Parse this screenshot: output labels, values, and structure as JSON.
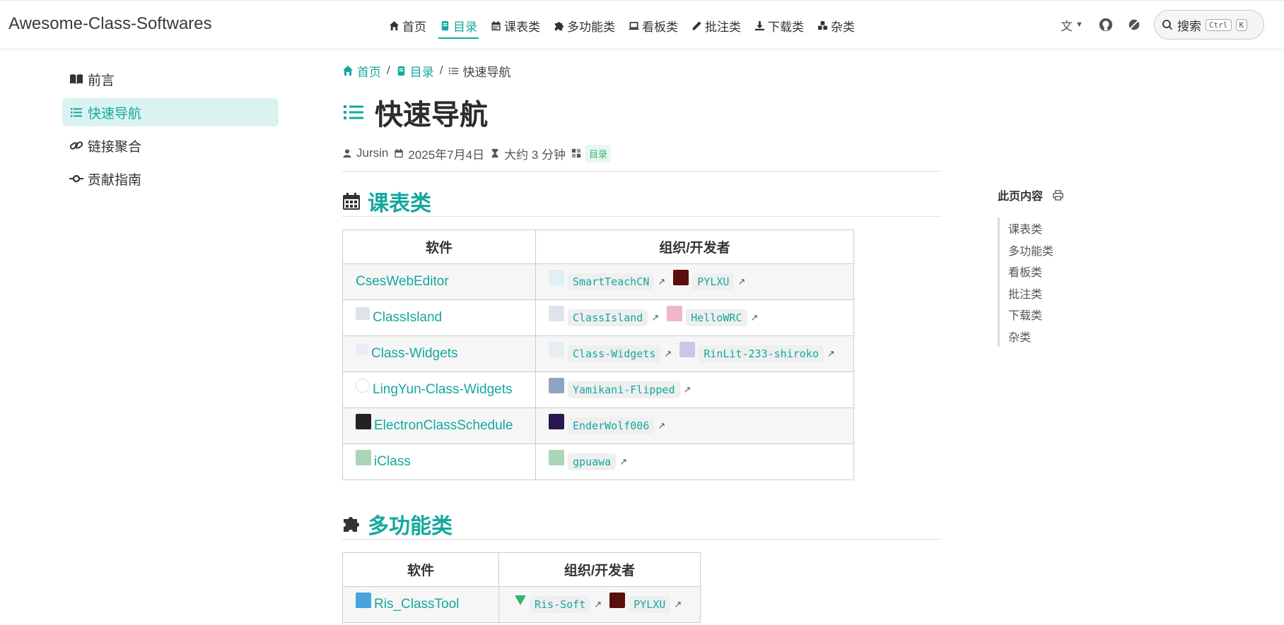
{
  "site": {
    "brand": "Awesome-Class-Softwares"
  },
  "nav": {
    "links": [
      {
        "label": "首页",
        "icon": "home-icon",
        "active": false
      },
      {
        "label": "目录",
        "icon": "book-icon",
        "active": true
      },
      {
        "label": "课表类",
        "icon": "calendar-icon",
        "active": false
      },
      {
        "label": "多功能类",
        "icon": "puzzle-icon",
        "active": false
      },
      {
        "label": "看板类",
        "icon": "laptop-icon",
        "active": false
      },
      {
        "label": "批注类",
        "icon": "pen-icon",
        "active": false
      },
      {
        "label": "下载类",
        "icon": "download-icon",
        "active": false
      },
      {
        "label": "杂类",
        "icon": "cubes-icon",
        "active": false
      }
    ],
    "search_label": "搜索",
    "search_key1": "Ctrl",
    "search_key2": "K"
  },
  "sidebar": {
    "items": [
      {
        "label": "前言",
        "icon": "open-book-icon",
        "active": false
      },
      {
        "label": "快速导航",
        "icon": "list-icon",
        "active": true
      },
      {
        "label": "链接聚合",
        "icon": "link-icon",
        "active": false
      },
      {
        "label": "贡献指南",
        "icon": "commit-icon",
        "active": false
      }
    ]
  },
  "breadcrumb": {
    "home": "首页",
    "toc": "目录",
    "current": "快速导航",
    "sep": "/"
  },
  "page": {
    "title": "快速导航",
    "author": "Jursin",
    "date": "2025年7月4日",
    "reading_time": "大约 3 分钟",
    "tag": "目录"
  },
  "sections": {
    "schedule": {
      "title": "课表类",
      "col1": "软件",
      "col2": "组织/开发者",
      "rows": [
        {
          "name": "CsesWebEditor",
          "devs": [
            "SmartTeachCN",
            "PYLXU"
          ]
        },
        {
          "name": "ClassIsland",
          "devs": [
            "ClassIsland",
            "HelloWRC"
          ]
        },
        {
          "name": "Class-Widgets",
          "devs": [
            "Class-Widgets",
            "RinLit-233-shiroko"
          ]
        },
        {
          "name": "LingYun-Class-Widgets",
          "devs": [
            "Yamikani-Flipped"
          ]
        },
        {
          "name": "ElectronClassSchedule",
          "devs": [
            "EnderWolf006"
          ]
        },
        {
          "name": "iClass",
          "devs": [
            "gpuawa"
          ]
        }
      ]
    },
    "multi": {
      "title": "多功能类",
      "col1": "软件",
      "col2": "组织/开发者",
      "rows": [
        {
          "name": "Ris_ClassTool",
          "devs": [
            "Ris-Soft",
            "PYLXU"
          ]
        }
      ]
    }
  },
  "toc": {
    "heading": "此页内容",
    "items": [
      "课表类",
      "多功能类",
      "看板类",
      "批注类",
      "下载类",
      "杂类"
    ]
  },
  "colors": {
    "accent": "#14a89e",
    "tag_bg": "#e8f7ef",
    "tag_fg": "#2fb86b"
  }
}
